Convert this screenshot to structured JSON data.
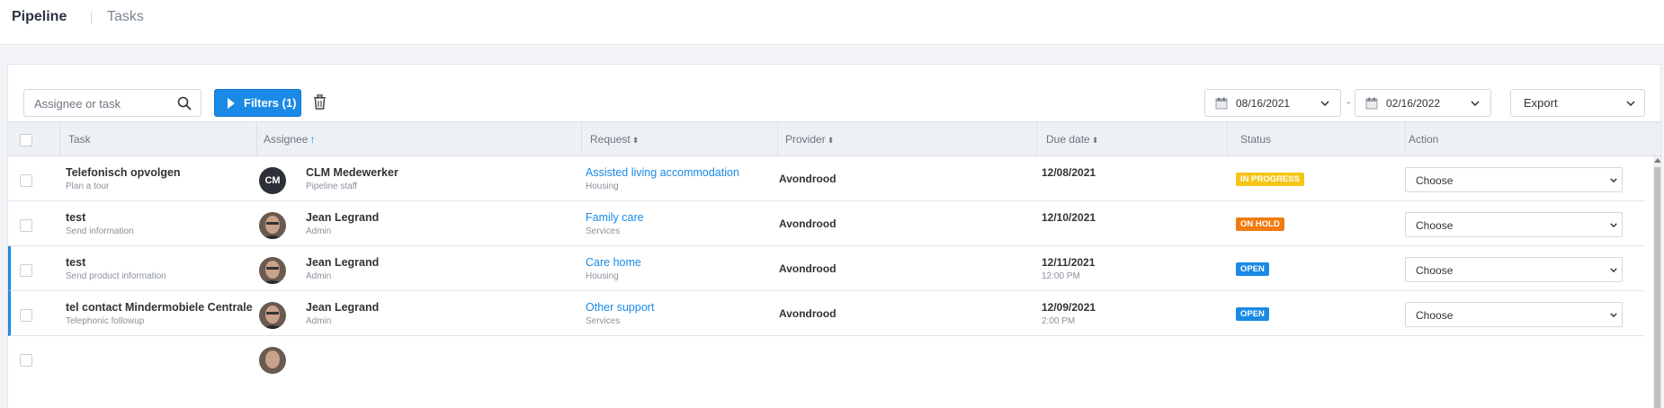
{
  "nav": {
    "tabs": [
      {
        "label": "Pipeline"
      },
      {
        "label": "Tasks"
      }
    ]
  },
  "toolbar": {
    "search_placeholder": "Assignee or task",
    "filters_label": "Filters (1)",
    "date_from": "08/16/2021",
    "date_separator": "-",
    "date_to": "02/16/2022",
    "export_label": "Export"
  },
  "table": {
    "columns": [
      "Task",
      "Assignee",
      "Request",
      "Provider",
      "Due date",
      "Status",
      "Action"
    ],
    "sort_glyphs": {
      "asc": "↑",
      "unsorted": "⬍"
    },
    "rows": [
      {
        "task": "Telefonisch opvolgen",
        "task_sub": "Plan a tour",
        "avatar": "CM",
        "assignee": "CLM Medewerker",
        "role": "Pipeline staff",
        "request": "Assisted living accommodation",
        "request_sub": "Housing",
        "provider": "Avondrood",
        "due": "12/08/2021",
        "due_time": "",
        "status": "IN PROGRESS",
        "action": "Choose"
      },
      {
        "task": "test",
        "task_sub": "Send information",
        "avatar": "",
        "assignee": "Jean Legrand",
        "role": "Admin",
        "request": "Family care",
        "request_sub": "Services",
        "provider": "Avondrood",
        "due": "12/10/2021",
        "due_time": "",
        "status": "ON HOLD",
        "action": "Choose"
      },
      {
        "task": "test",
        "task_sub": "Send product information",
        "avatar": "",
        "assignee": "Jean Legrand",
        "role": "Admin",
        "request": "Care home",
        "request_sub": "Housing",
        "provider": "Avondrood",
        "due": "12/11/2021",
        "due_time": "12:00 PM",
        "status": "OPEN",
        "action": "Choose"
      },
      {
        "task": "tel contact Mindermobiele Centrale",
        "task_sub": "Telephonic followup",
        "avatar": "",
        "assignee": "Jean Legrand",
        "role": "Admin",
        "request": "Other support",
        "request_sub": "Services",
        "provider": "Avondrood",
        "due": "12/09/2021",
        "due_time": "2:00 PM",
        "status": "OPEN",
        "action": "Choose"
      }
    ]
  },
  "colors": {
    "accent": "#1a8ae6",
    "in_progress": "#f5c518",
    "on_hold": "#f07b10",
    "open": "#1a8ae6"
  }
}
